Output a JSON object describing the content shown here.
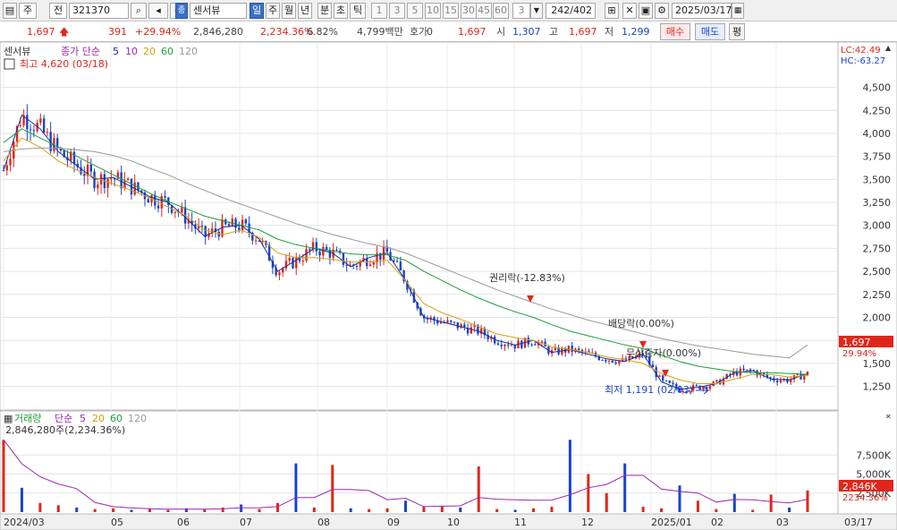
{
  "toolbar": {
    "market": "주",
    "prev": "전",
    "code": "321370",
    "stock_name": "센서뷰",
    "stock_prefix": "종",
    "periods": [
      "일",
      "주",
      "월",
      "년",
      "분",
      "초",
      "틱"
    ],
    "active_period": "일",
    "intervals": [
      "1",
      "3",
      "5",
      "10",
      "15",
      "30",
      "45",
      "60"
    ],
    "count": "3",
    "page": "242/402",
    "date": "2025/03/17"
  },
  "quote": {
    "price": "1,697",
    "change": "391",
    "change_rate": "+29.94%",
    "volume": "2,846,280",
    "volume_rate": "2,234.36%",
    "turnover": "6.82%",
    "amount": "4,799백만",
    "hoga_label": "호가",
    "hoga_value": "0",
    "hoga_price": "1,697",
    "open_label": "시",
    "open": "1,307",
    "high_label": "고",
    "high": "1,697",
    "low_label": "저",
    "low": "1,299",
    "buy": "매수",
    "sell": "매도",
    "extra": "평"
  },
  "price_panel": {
    "name": "센서뷰",
    "legend_prefix": "종가 단순",
    "ma_labels": [
      {
        "label": "5",
        "color": "#1a2d9e"
      },
      {
        "label": "10",
        "color": "#9d27b0"
      },
      {
        "label": "20",
        "color": "#d4a017"
      },
      {
        "label": "60",
        "color": "#1f9e3a"
      },
      {
        "label": "120",
        "color": "#999999"
      }
    ],
    "high_note": "최고 4,620 (03/18)",
    "low_note": "최저 1,191 (02/03)",
    "lc": "LC:42.49",
    "hc": "HC:-63.27",
    "current_price": "1,697",
    "current_rate": "29.94%",
    "annotations": [
      "권리락(-12.83%)",
      "배당락(0.00%)",
      "무상증자(0.00%)"
    ]
  },
  "volume_panel": {
    "name": "거래량",
    "legend_prefix": "단순",
    "ma_labels": [
      {
        "label": "5",
        "color": "#9d27b0"
      },
      {
        "label": "20",
        "color": "#d4a017"
      },
      {
        "label": "60",
        "color": "#1f9e3a"
      },
      {
        "label": "120",
        "color": "#999999"
      }
    ],
    "sub_label": "2,846,280주(2,234.36%)",
    "current_volume": "2,846K",
    "current_rate": "2234.36%"
  },
  "colors": {
    "up": "#e0261b",
    "down": "#1a44c8",
    "ma5": "#1a2d9e",
    "ma10": "#9d27b0",
    "ma20": "#d4a017",
    "ma60": "#1f9e3a",
    "ma120": "#999999"
  },
  "chart_data": [
    {
      "type": "candlestick",
      "title": "센서뷰",
      "ylim": [
        1100,
        4700
      ],
      "y_ticks": [
        "4,500",
        "4,250",
        "4,000",
        "3,750",
        "3,500",
        "3,250",
        "3,000",
        "2,750",
        "2,500",
        "2,250",
        "2,000",
        "1,750",
        "1,500",
        "1,250"
      ],
      "x_ticks": [
        "2024/03",
        "05",
        "06",
        "07",
        "08",
        "09",
        "10",
        "11",
        "12",
        "2025/01",
        "02",
        "03"
      ],
      "date_label": "03/17",
      "series": [
        {
          "name": "종가 단순 5",
          "values": [
            3600,
            4200,
            4050,
            3800,
            3650,
            3500,
            3520,
            3420,
            3310,
            3250,
            3080,
            2880,
            2980,
            3000,
            2850,
            2500,
            2620,
            2750,
            2700,
            2550,
            2650,
            2700,
            2400,
            2000,
            1950,
            1900,
            1850,
            1750,
            1700,
            1750,
            1620,
            1650,
            1600,
            1550,
            1520,
            1600,
            1300,
            1220,
            1240,
            1280,
            1400,
            1420,
            1330,
            1320,
            1390
          ]
        },
        {
          "name": "종가 단순 20",
          "values": [
            3700,
            3950,
            3850,
            3700,
            3600,
            3520,
            3450,
            3380,
            3300,
            3200,
            3100,
            2950,
            2900,
            2950,
            2870,
            2700,
            2650,
            2650,
            2630,
            2600,
            2600,
            2620,
            2400,
            2150,
            2050,
            1980,
            1900,
            1820,
            1780,
            1750,
            1680,
            1650,
            1620,
            1570,
            1540,
            1500,
            1390,
            1320,
            1280,
            1280,
            1330,
            1380,
            1380,
            1350,
            1370
          ]
        },
        {
          "name": "종가 단순 60",
          "values": [
            3900,
            4050,
            3950,
            3850,
            3750,
            3650,
            3550,
            3450,
            3350,
            3260,
            3180,
            3100,
            3050,
            3000,
            2950,
            2850,
            2790,
            2750,
            2720,
            2690,
            2680,
            2680,
            2620,
            2500,
            2400,
            2300,
            2210,
            2130,
            2060,
            2000,
            1920,
            1850,
            1800,
            1750,
            1700,
            1660,
            1590,
            1520,
            1470,
            1440,
            1410,
            1400,
            1400,
            1390,
            1380
          ]
        },
        {
          "name": "종가 단순 120",
          "values": [
            3800,
            3830,
            3840,
            3840,
            3820,
            3800,
            3760,
            3700,
            3620,
            3550,
            3460,
            3380,
            3300,
            3230,
            3160,
            3090,
            3020,
            2960,
            2900,
            2850,
            2800,
            2760,
            2700,
            2620,
            2540,
            2460,
            2380,
            2300,
            2230,
            2160,
            2090,
            2030,
            1970,
            1920,
            1870,
            1820,
            1770,
            1730,
            1690,
            1660,
            1630,
            1600,
            1580,
            1560,
            1700
          ]
        }
      ]
    },
    {
      "type": "bar",
      "title": "거래량",
      "y_ticks": [
        "7,500K",
        "5,000K",
        "2,500K"
      ],
      "ylim": [
        0,
        10000
      ],
      "series": [
        {
          "name": "거래량",
          "values": [
            9500,
            3200,
            1200,
            900,
            600,
            400,
            500,
            300,
            400,
            300,
            500,
            400,
            600,
            1000,
            400,
            1200,
            6400,
            600,
            6200,
            500,
            400,
            500,
            1500,
            700,
            800,
            600,
            6000,
            400,
            300,
            500,
            700,
            9500,
            5000,
            2500,
            6400,
            700,
            500,
            3500,
            1500,
            400,
            2400,
            300,
            2300,
            600,
            2846
          ]
        }
      ]
    }
  ]
}
